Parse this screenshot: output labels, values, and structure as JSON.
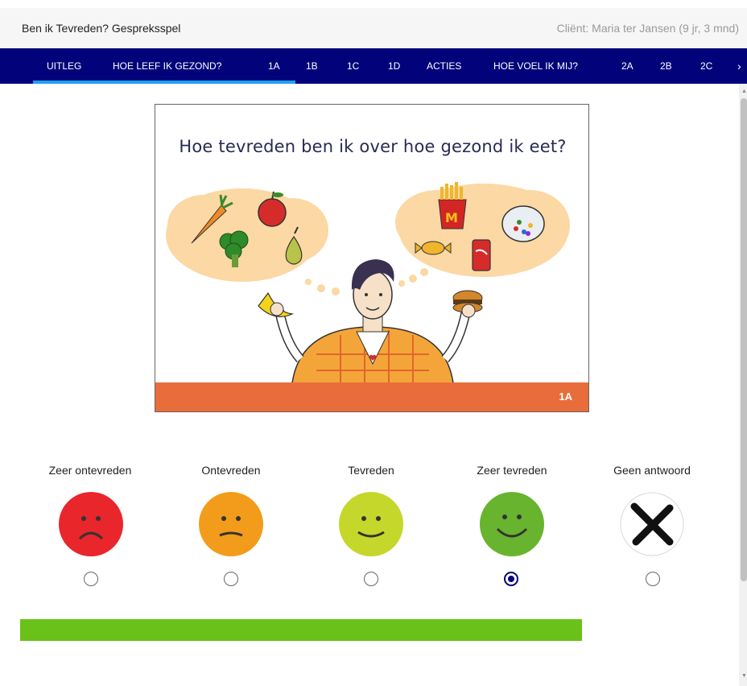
{
  "header": {
    "app_title": "Ben ik Tevreden? Gespreksspel",
    "client_label": "Cliënt: Maria ter Jansen (9 jr, 3 mnd)"
  },
  "nav": {
    "tabs": [
      {
        "label": "UITLEG",
        "active": false
      },
      {
        "label": "HOE LEEF IK GEZOND?",
        "active": true
      },
      {
        "label": "1A",
        "active": true
      },
      {
        "label": "1B",
        "active": false
      },
      {
        "label": "1C",
        "active": false
      },
      {
        "label": "1D",
        "active": false
      },
      {
        "label": "ACTIES",
        "active": false
      },
      {
        "label": "HOE VOEL IK MIJ?",
        "active": false
      },
      {
        "label": "2A",
        "active": false
      },
      {
        "label": "2B",
        "active": false
      },
      {
        "label": "2C",
        "active": false
      }
    ],
    "more_icon": "chevron-right-icon",
    "more_glyph": "›",
    "bar_color": "#02037a",
    "indicator_color": "#1ea0f0"
  },
  "card": {
    "question": "Hoe tevreden ben ik over hoe gezond ik eet?",
    "code": "1A",
    "footer_color": "#e86d3a"
  },
  "options": [
    {
      "label": "Zeer ontevreden",
      "icon": "very-sad-face-icon",
      "color": "#e8262b",
      "selected": false
    },
    {
      "label": "Ontevreden",
      "icon": "sad-face-icon",
      "color": "#f39c1b",
      "selected": false
    },
    {
      "label": "Tevreden",
      "icon": "happy-face-icon",
      "color": "#c5d72a",
      "selected": false
    },
    {
      "label": "Zeer tevreden",
      "icon": "very-happy-face-icon",
      "color": "#68b42e",
      "selected": true
    },
    {
      "label": "Geen antwoord",
      "icon": "no-answer-x-icon",
      "color": "#ffffff",
      "selected": false
    }
  ],
  "progress": {
    "fraction": 1.0,
    "color": "#6ac11a"
  }
}
